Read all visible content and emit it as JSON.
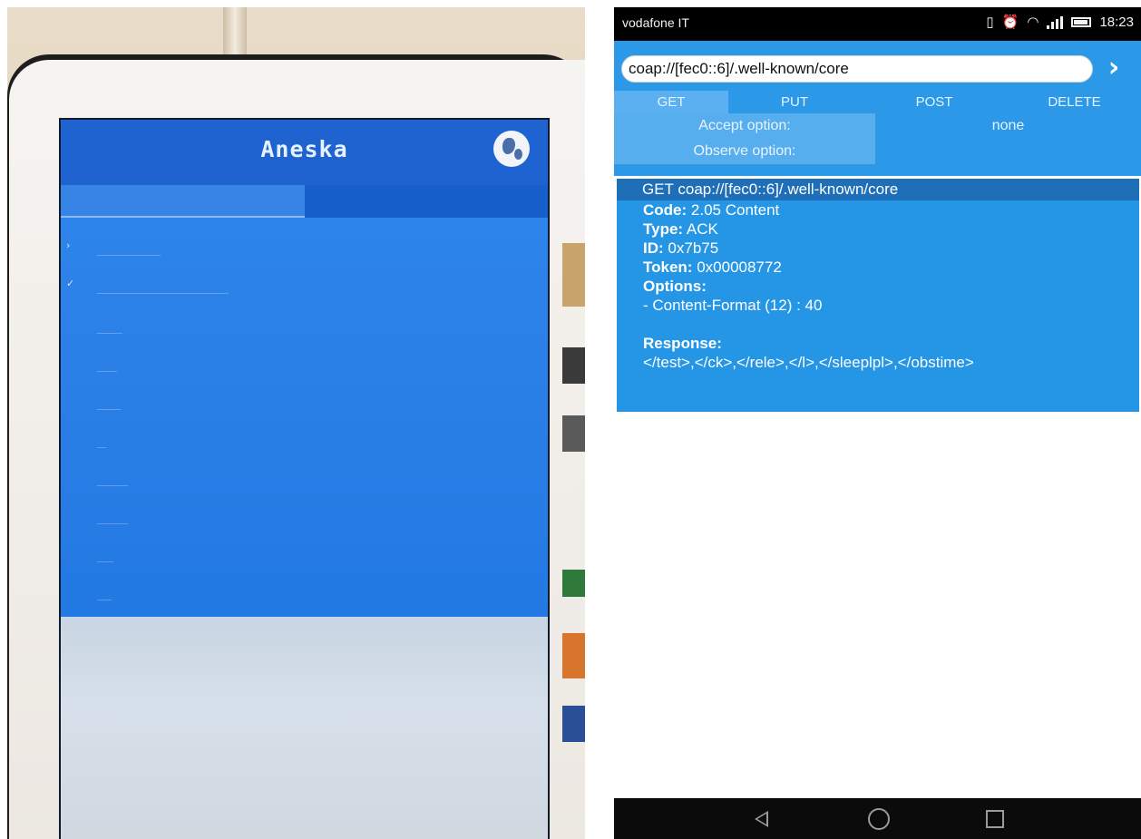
{
  "left_photo": {
    "tablet_app_title": "Aneska",
    "globe_icon": "globe-icon",
    "colors": {
      "app_blue": "#1f6ed6",
      "header_blue": "#1e63cf"
    }
  },
  "phone": {
    "status_bar": {
      "carrier": "vodafone IT",
      "time": "18:23",
      "icons": [
        "vibrate-icon",
        "alarm-icon",
        "wifi-icon",
        "signal-icon",
        "battery-icon"
      ]
    },
    "url_input": {
      "value": "coap://[fec0::6]/.well-known/core"
    },
    "go_button": {
      "label": "›"
    },
    "methods": [
      {
        "label": "GET",
        "active": true
      },
      {
        "label": "PUT",
        "active": false
      },
      {
        "label": "POST",
        "active": false
      },
      {
        "label": "DELETE",
        "active": false
      }
    ],
    "accept_option": {
      "label": "Accept option:",
      "value": "none"
    },
    "observe_option": {
      "label": "Observe option:",
      "value": ""
    },
    "response": {
      "header": "GET coap://[fec0::6]/.well-known/core",
      "code_label": "Code:",
      "code_value": "2.05 Content",
      "type_label": "Type:",
      "type_value": "ACK",
      "id_label": "ID:",
      "id_value": "0x7b75",
      "token_label": "Token:",
      "token_value": "0x00008772",
      "options_label": "Options:",
      "option_line": "- Content-Format (12) : 40",
      "response_label": "Response:",
      "response_value": "</test>,</ck>,</rele>,</l>,</sleeplpl>,</obstime>"
    },
    "nav_bar": {
      "icons": [
        "back-icon",
        "home-icon",
        "recents-icon"
      ]
    },
    "colors": {
      "panel_blue": "#2b98e8",
      "active_tab": "#5ab0f0",
      "response_header": "#1f6fb8",
      "response_bg": "#2596e6"
    }
  }
}
